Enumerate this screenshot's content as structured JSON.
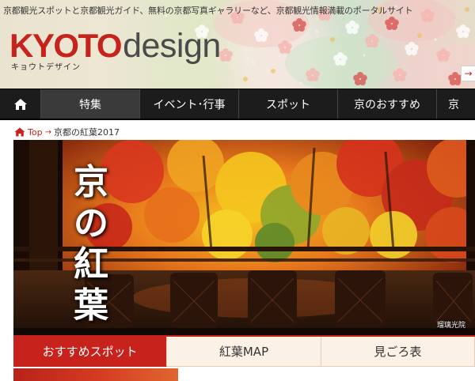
{
  "header": {
    "tagline": "京都観光スポットと京都観光ガイド、無料の京都写真ギャラリーなど、京都観光情報満載のポータルサイト",
    "logo_main": "KYOTO",
    "logo_sub": "design",
    "logo_kana": "キョウトデザイン",
    "next_glyph": "→"
  },
  "nav": {
    "home_icon": "home-icon",
    "items": [
      {
        "label": "特集"
      },
      {
        "label": "イベント･行事"
      },
      {
        "label": "スポット"
      },
      {
        "label": "京のおすすめ"
      },
      {
        "label": "京"
      }
    ]
  },
  "breadcrumb": {
    "home": "Top",
    "arrow": "→",
    "current": "京都の紅葉2017"
  },
  "hero": {
    "title": "京の紅葉",
    "caption": "瑠璃光院"
  },
  "tabs": [
    {
      "label": "おすすめスポット",
      "active": true
    },
    {
      "label": "紅葉MAP",
      "active": false
    },
    {
      "label": "見ごろ表",
      "active": false
    }
  ],
  "colors": {
    "brand_red": "#c6231c",
    "nav_bg": "#1c1c1c",
    "tab_bg": "#fbf1e6"
  }
}
